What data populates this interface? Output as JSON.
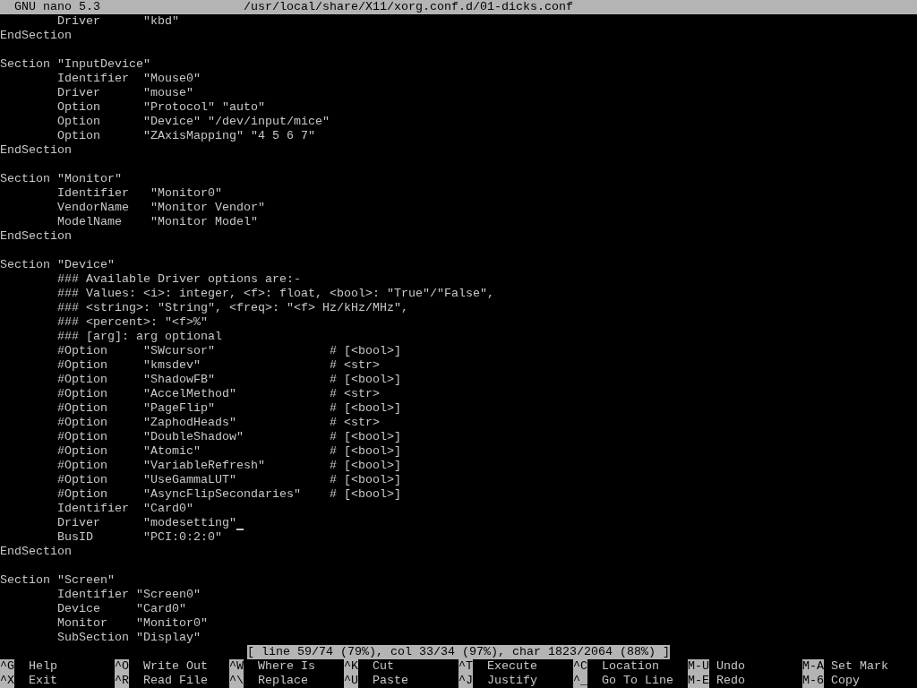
{
  "title_bar": {
    "app": "GNU nano 5.3",
    "path": "/usr/local/share/X11/xorg.conf.d/01-dicks.conf"
  },
  "blocks": [
    {
      "lines": [
        {
          "text": "Driver      \"kbd\"",
          "indent": true,
          "cursor": false
        },
        {
          "text": "EndSection",
          "indent": false,
          "cursor": false
        }
      ]
    },
    {
      "lines": [
        {
          "text": "Section \"InputDevice\"",
          "indent": false,
          "cursor": false
        },
        {
          "text": "Identifier  \"Mouse0\"",
          "indent": true,
          "cursor": false
        },
        {
          "text": "Driver      \"mouse\"",
          "indent": true,
          "cursor": false
        },
        {
          "text": "Option      \"Protocol\" \"auto\"",
          "indent": true,
          "cursor": false
        },
        {
          "text": "Option      \"Device\" \"/dev/input/mice\"",
          "indent": true,
          "cursor": false
        },
        {
          "text": "Option      \"ZAxisMapping\" \"4 5 6 7\"",
          "indent": true,
          "cursor": false
        },
        {
          "text": "EndSection",
          "indent": false,
          "cursor": false
        }
      ]
    },
    {
      "lines": [
        {
          "text": "Section \"Monitor\"",
          "indent": false,
          "cursor": false
        },
        {
          "text": "Identifier   \"Monitor0\"",
          "indent": true,
          "cursor": false
        },
        {
          "text": "VendorName   \"Monitor Vendor\"",
          "indent": true,
          "cursor": false
        },
        {
          "text": "ModelName    \"Monitor Model\"",
          "indent": true,
          "cursor": false
        },
        {
          "text": "EndSection",
          "indent": false,
          "cursor": false
        }
      ]
    },
    {
      "lines": [
        {
          "text": "Section \"Device\"",
          "indent": false,
          "cursor": false
        },
        {
          "text": "### Available Driver options are:-",
          "indent": true,
          "cursor": false
        },
        {
          "text": "### Values: <i>: integer, <f>: float, <bool>: \"True\"/\"False\",",
          "indent": true,
          "cursor": false
        },
        {
          "text": "### <string>: \"String\", <freq>: \"<f> Hz/kHz/MHz\",",
          "indent": true,
          "cursor": false
        },
        {
          "text": "### <percent>: \"<f>%\"",
          "indent": true,
          "cursor": false
        },
        {
          "text": "### [arg]: arg optional",
          "indent": true,
          "cursor": false
        },
        {
          "text": "#Option     \"SWcursor\"                # [<bool>]",
          "indent": true,
          "cursor": false
        },
        {
          "text": "#Option     \"kmsdev\"                  # <str>",
          "indent": true,
          "cursor": false
        },
        {
          "text": "#Option     \"ShadowFB\"                # [<bool>]",
          "indent": true,
          "cursor": false
        },
        {
          "text": "#Option     \"AccelMethod\"             # <str>",
          "indent": true,
          "cursor": false
        },
        {
          "text": "#Option     \"PageFlip\"                # [<bool>]",
          "indent": true,
          "cursor": false
        },
        {
          "text": "#Option     \"ZaphodHeads\"             # <str>",
          "indent": true,
          "cursor": false
        },
        {
          "text": "#Option     \"DoubleShadow\"            # [<bool>]",
          "indent": true,
          "cursor": false
        },
        {
          "text": "#Option     \"Atomic\"                  # [<bool>]",
          "indent": true,
          "cursor": false
        },
        {
          "text": "#Option     \"VariableRefresh\"         # [<bool>]",
          "indent": true,
          "cursor": false
        },
        {
          "text": "#Option     \"UseGammaLUT\"             # [<bool>]",
          "indent": true,
          "cursor": false
        },
        {
          "text": "#Option     \"AsyncFlipSecondaries\"    # [<bool>]",
          "indent": true,
          "cursor": false
        },
        {
          "text": "Identifier  \"Card0\"",
          "indent": true,
          "cursor": false
        },
        {
          "text": "Driver      \"modesetting\"",
          "indent": true,
          "cursor": true
        },
        {
          "text": "BusID       \"PCI:0:2:0\"",
          "indent": true,
          "cursor": false
        },
        {
          "text": "EndSection",
          "indent": false,
          "cursor": false
        }
      ]
    },
    {
      "lines": [
        {
          "text": "Section \"Screen\"",
          "indent": false,
          "cursor": false
        },
        {
          "text": "Identifier \"Screen0\"",
          "indent": true,
          "cursor": false
        },
        {
          "text": "Device     \"Card0\"",
          "indent": true,
          "cursor": false
        },
        {
          "text": "Monitor    \"Monitor0\"",
          "indent": true,
          "cursor": false
        },
        {
          "text": "SubSection \"Display\"",
          "indent": true,
          "cursor": false
        }
      ]
    }
  ],
  "status": "[ line 59/74 (79%), col 33/34 (97%), char 1823/2064 (88%) ]",
  "shortcut_rows": [
    [
      {
        "key": "^G",
        "label": "Help"
      },
      {
        "key": "^O",
        "label": "Write Out"
      },
      {
        "key": "^W",
        "label": "Where Is"
      },
      {
        "key": "^K",
        "label": "Cut"
      },
      {
        "key": "^T",
        "label": "Execute"
      },
      {
        "key": "^C",
        "label": "Location"
      },
      {
        "key": "M-U",
        "label": "Undo"
      },
      {
        "key": "M-A",
        "label": "Set Mark"
      }
    ],
    [
      {
        "key": "^X",
        "label": "Exit"
      },
      {
        "key": "^R",
        "label": "Read File"
      },
      {
        "key": "^\\",
        "label": "Replace"
      },
      {
        "key": "^U",
        "label": "Paste"
      },
      {
        "key": "^J",
        "label": "Justify"
      },
      {
        "key": "^_",
        "label": "Go To Line"
      },
      {
        "key": "M-E",
        "label": "Redo"
      },
      {
        "key": "M-6",
        "label": "Copy"
      }
    ]
  ]
}
